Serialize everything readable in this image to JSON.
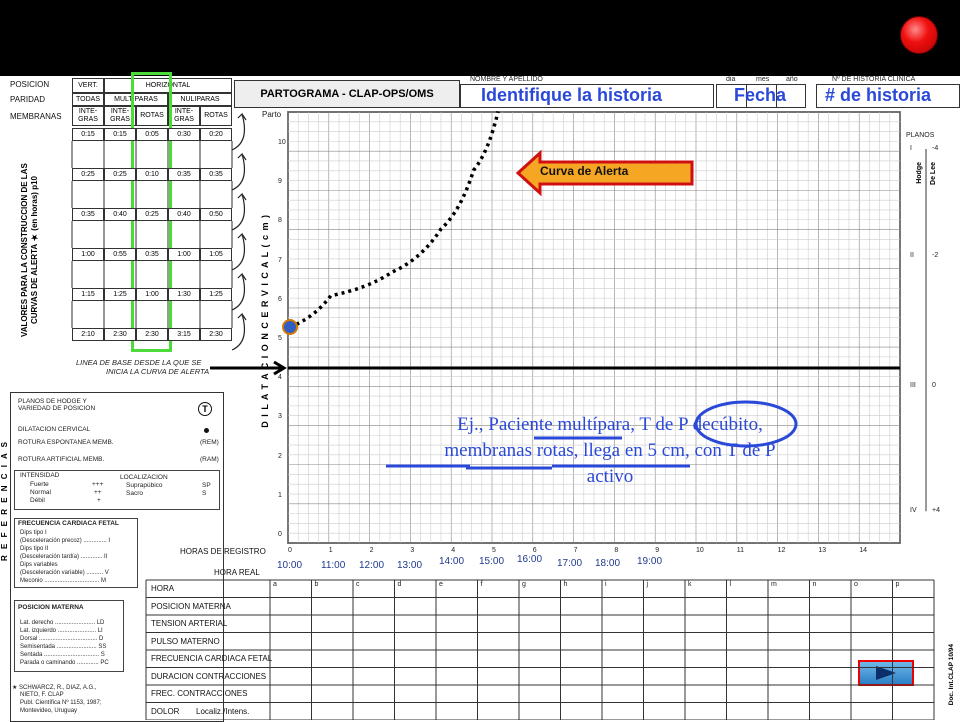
{
  "header": {
    "form_title": "PARTOGRAMA - CLAP-OPS/OMS",
    "name_label": "NOMBRE Y APELLIDO",
    "name_value": "Identifique la historia",
    "date_labels": [
      "dia",
      "mes",
      "año"
    ],
    "date_value": "Fecha",
    "record_label": "Nº DE HISTORIA CLINICA",
    "record_value": "# de historia"
  },
  "table": {
    "row_labels": [
      "POSICION",
      "PARIDAD",
      "MEMBRANAS"
    ],
    "vert_label": "VERT.",
    "horiz_label": "HORIZONTAL",
    "paridad": [
      "TODAS",
      "MULTIPARAS",
      "NULIPARAS"
    ],
    "membranas": [
      "INTE-GRAS",
      "INTE-GRAS",
      "ROTAS",
      "INTE-GRAS",
      "ROTAS"
    ],
    "values": [
      [
        "0:15",
        "0:15",
        "0:05",
        "0:30",
        "0:20"
      ],
      [
        "0:25",
        "0:25",
        "0:10",
        "0:35",
        "0:35"
      ],
      [
        "0:35",
        "0:40",
        "0:25",
        "0:40",
        "0:50"
      ],
      [
        "1:00",
        "0:55",
        "0:35",
        "1:00",
        "1:05"
      ],
      [
        "1:15",
        "1:25",
        "1:00",
        "1:30",
        "1:25"
      ],
      [
        "2:10",
        "2:30",
        "2:30",
        "3:15",
        "2:30"
      ]
    ],
    "side_title": "VALORES PARA LA CONSTRUCCION DE LAS CURVAS DE ALERTA ★ (en horas) p10",
    "baseline_note_1": "LINEA DE BASE DESDE LA QUE SE",
    "baseline_note_2": "INICIA LA CURVA DE ALERTA"
  },
  "chart": {
    "parto_label": "Parto",
    "y_ticks": [
      "10",
      "9",
      "8",
      "7",
      "6",
      "5",
      "4",
      "3",
      "2",
      "1",
      "0"
    ],
    "dilatacion_label": "D I L A T A C I O N   C E R V I C A L   ( c m )",
    "x_ticks": [
      "0",
      "1",
      "2",
      "3",
      "4",
      "5",
      "6",
      "7",
      "8",
      "9",
      "10",
      "11",
      "12",
      "13",
      "14"
    ],
    "horas_registro": "HORAS DE REGISTRO",
    "hora_real": "HORA REAL",
    "real_times": [
      "10:00",
      "11:00",
      "12:00",
      "13:00",
      "14:00",
      "15:00",
      "16:00",
      "17:00",
      "18:00",
      "19:00"
    ],
    "planos_label": "PLANOS",
    "hodge_label": "Hodge",
    "delee_label": "De Lee",
    "planos": [
      {
        "roman": "I",
        "delee": "-4"
      },
      {
        "roman": "II",
        "delee": "-2"
      },
      {
        "roman": "III",
        "delee": "0"
      },
      {
        "roman": "IV",
        "delee": "+4"
      }
    ],
    "alert_label": "Curva de Alerta",
    "alert_curve": [
      {
        "hour": 0,
        "cm": 5
      },
      {
        "hour": 1,
        "cm": 5.8
      },
      {
        "hour": 2.5,
        "cm": 6.4
      },
      {
        "hour": 3.7,
        "cm": 7.5
      },
      {
        "hour": 4.5,
        "cm": 9
      },
      {
        "hour": 5.1,
        "cm": 10.5
      }
    ],
    "start_point": {
      "hour": 0,
      "cm": 5
    }
  },
  "annotation": {
    "line1": "Ej., Paciente multípara, T de P decúbito,",
    "line2": "membranas rotas, llega en 5 cm,  con T de P",
    "line3": "activo"
  },
  "referencias": {
    "title": "R E F E R E N C I A S",
    "planos_title": "PLANOS DE HODGE Y VARIEDAD DE POSICION",
    "dilat": "DILATACION CERVICAL",
    "rem": "ROTURA ESPONTANEA MEMB.",
    "rem_code": "(REM)",
    "ram": "ROTURA ARTIFICIAL MEMB.",
    "ram_code": "(RAM)",
    "intensidad": "INTENSIDAD",
    "fuerte": "Fuerte",
    "fuerte_code": "+++",
    "normal": "Normal",
    "normal_code": "++",
    "debil": "Débil",
    "debil_code": "+",
    "localizacion": "LOCALIZACION",
    "supra": "Suprapúbico",
    "supra_code": "SP",
    "sacro": "Sacro",
    "sacro_code": "S",
    "fcf_title": "FRECUENCIA CARDIACA FETAL",
    "fcf_items": [
      "Dips tipo I",
      "(Desceleración precoz) .............. I",
      "Dips tipo II",
      "(Desceleración tardía) ............. II",
      "Dips variables",
      "(Desceleración variable) .......... V",
      "Meconio ................................. M"
    ],
    "pos_title": "POSICION MATERNA",
    "pos_items": [
      "Lat. derecho ........................ LD",
      "Lat. izquierdo ....................... LI",
      "Dorsal ................................... D",
      "Semisentada ........................ SS",
      "Sentada ................................. S",
      "Parada o caminando ............. PC"
    ],
    "citation": [
      "★ SCHWARCZ, R., DIAZ, A.G.,",
      "NIETO, F. CLAP",
      "Publ. Científica Nº 1153, 1987;",
      "Montevideo, Uruguay"
    ]
  },
  "grid": {
    "rows": [
      "HORA",
      "POSICION MATERNA",
      "TENSION ARTERIAL",
      "PULSO MATERNO",
      "FRECUENCIA CARDIACA FETAL",
      "DURACION CONTRACCIONES",
      "FREC. CONTRACCIONES",
      "DOLOR"
    ],
    "dolor_sub": "Localiz./Intens.",
    "cols": [
      "a",
      "b",
      "c",
      "d",
      "e",
      "f",
      "g",
      "h",
      "i",
      "j",
      "k",
      "l",
      "m",
      "n",
      "o",
      "p"
    ]
  },
  "footer": {
    "doc_code": "Doc. Int.CLAP 10/94"
  },
  "colors": {
    "highlight_green": "#4ddb3a",
    "annotation_blue": "#2a49d8",
    "alert_orange": "#f5a623",
    "alert_border": "#d01010"
  }
}
